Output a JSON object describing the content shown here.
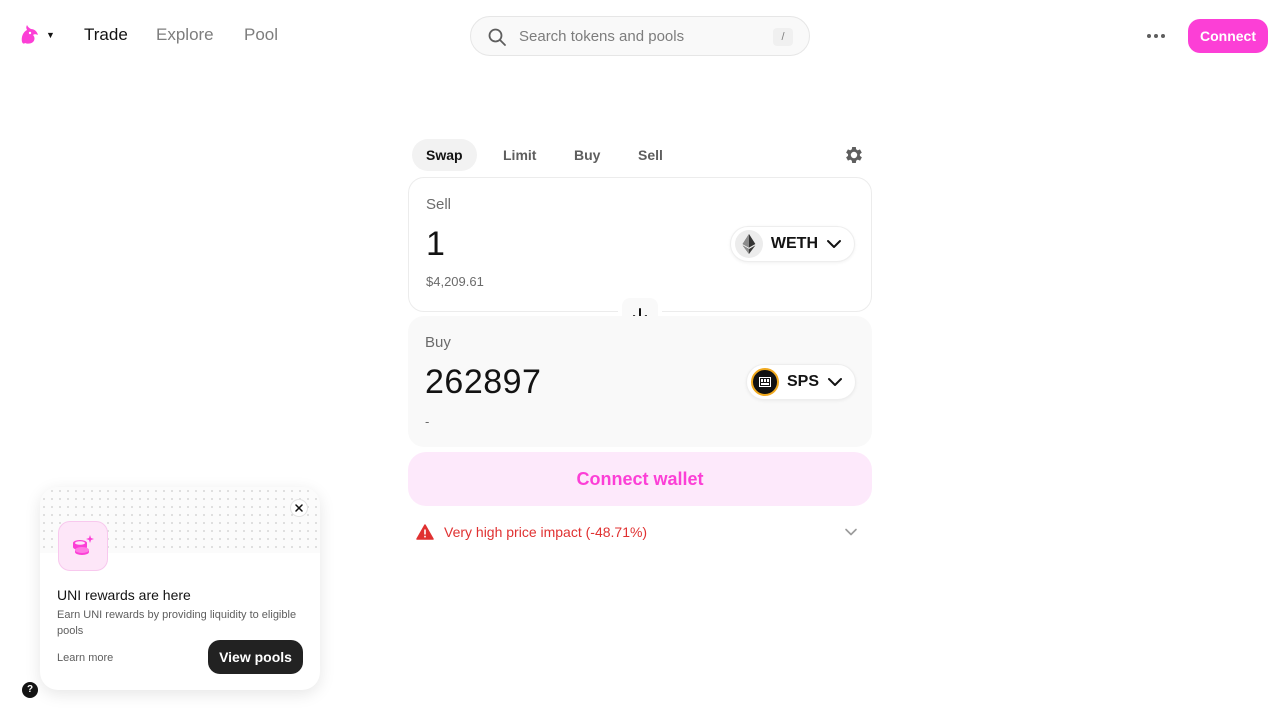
{
  "nav": {
    "links": [
      "Trade",
      "Explore",
      "Pool"
    ],
    "search_placeholder": "Search tokens and pools",
    "search_shortcut": "/",
    "connect_label": "Connect"
  },
  "swap": {
    "tabs": [
      "Swap",
      "Limit",
      "Buy",
      "Sell"
    ],
    "active_tab": "Swap",
    "sell": {
      "label": "Sell",
      "amount": "1",
      "usd_value": "$4,209.61",
      "token": "WETH"
    },
    "buy": {
      "label": "Buy",
      "amount": "262897",
      "usd_value": "-",
      "token": "SPS"
    },
    "wallet_button": "Connect wallet",
    "warning": "Very high price impact (-48.71%)"
  },
  "rewards_card": {
    "title": "UNI rewards are here",
    "description": "Earn UNI rewards by providing liquidity to eligible pools",
    "learn_more": "Learn more",
    "button": "View pools"
  },
  "help_label": "?",
  "colors": {
    "accent": "#fc3fd6",
    "accent_soft": "#fde9fb",
    "warning": "#e03131"
  }
}
